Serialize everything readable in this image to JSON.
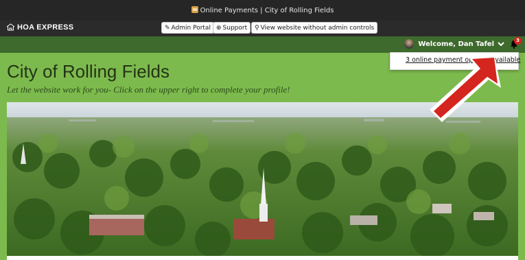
{
  "browser": {
    "tab_title": "Online Payments | City of Rolling Fields"
  },
  "admin_bar": {
    "logo_text": "HOA EXPRESS",
    "admin_portal_label": "Admin Portal",
    "support_label": "Support",
    "view_website_label": "View website without admin controls"
  },
  "user_bar": {
    "welcome_text": "Welcome, Dan Tafel",
    "notification_count": "3"
  },
  "dropdown": {
    "notification_link": "3 online payment options available"
  },
  "site": {
    "title": "City of Rolling Fields",
    "tagline": "Let the website work for you- Click on the upper right to complete your profile!"
  },
  "icons": {
    "logo": "house-icon",
    "admin_portal": "wrench-icon",
    "support": "lifebuoy-icon",
    "view_website": "magnifier-icon",
    "user_menu": "chevron-down-icon",
    "notifications": "bell-icon",
    "callout": "red-arrow"
  },
  "colors": {
    "title_bar": "#262626",
    "admin_bar": "#2b2b2b",
    "user_bar": "#3e6a2d",
    "header": "#7dba4e",
    "badge": "#d4261e",
    "arrow": "#d4261e"
  }
}
